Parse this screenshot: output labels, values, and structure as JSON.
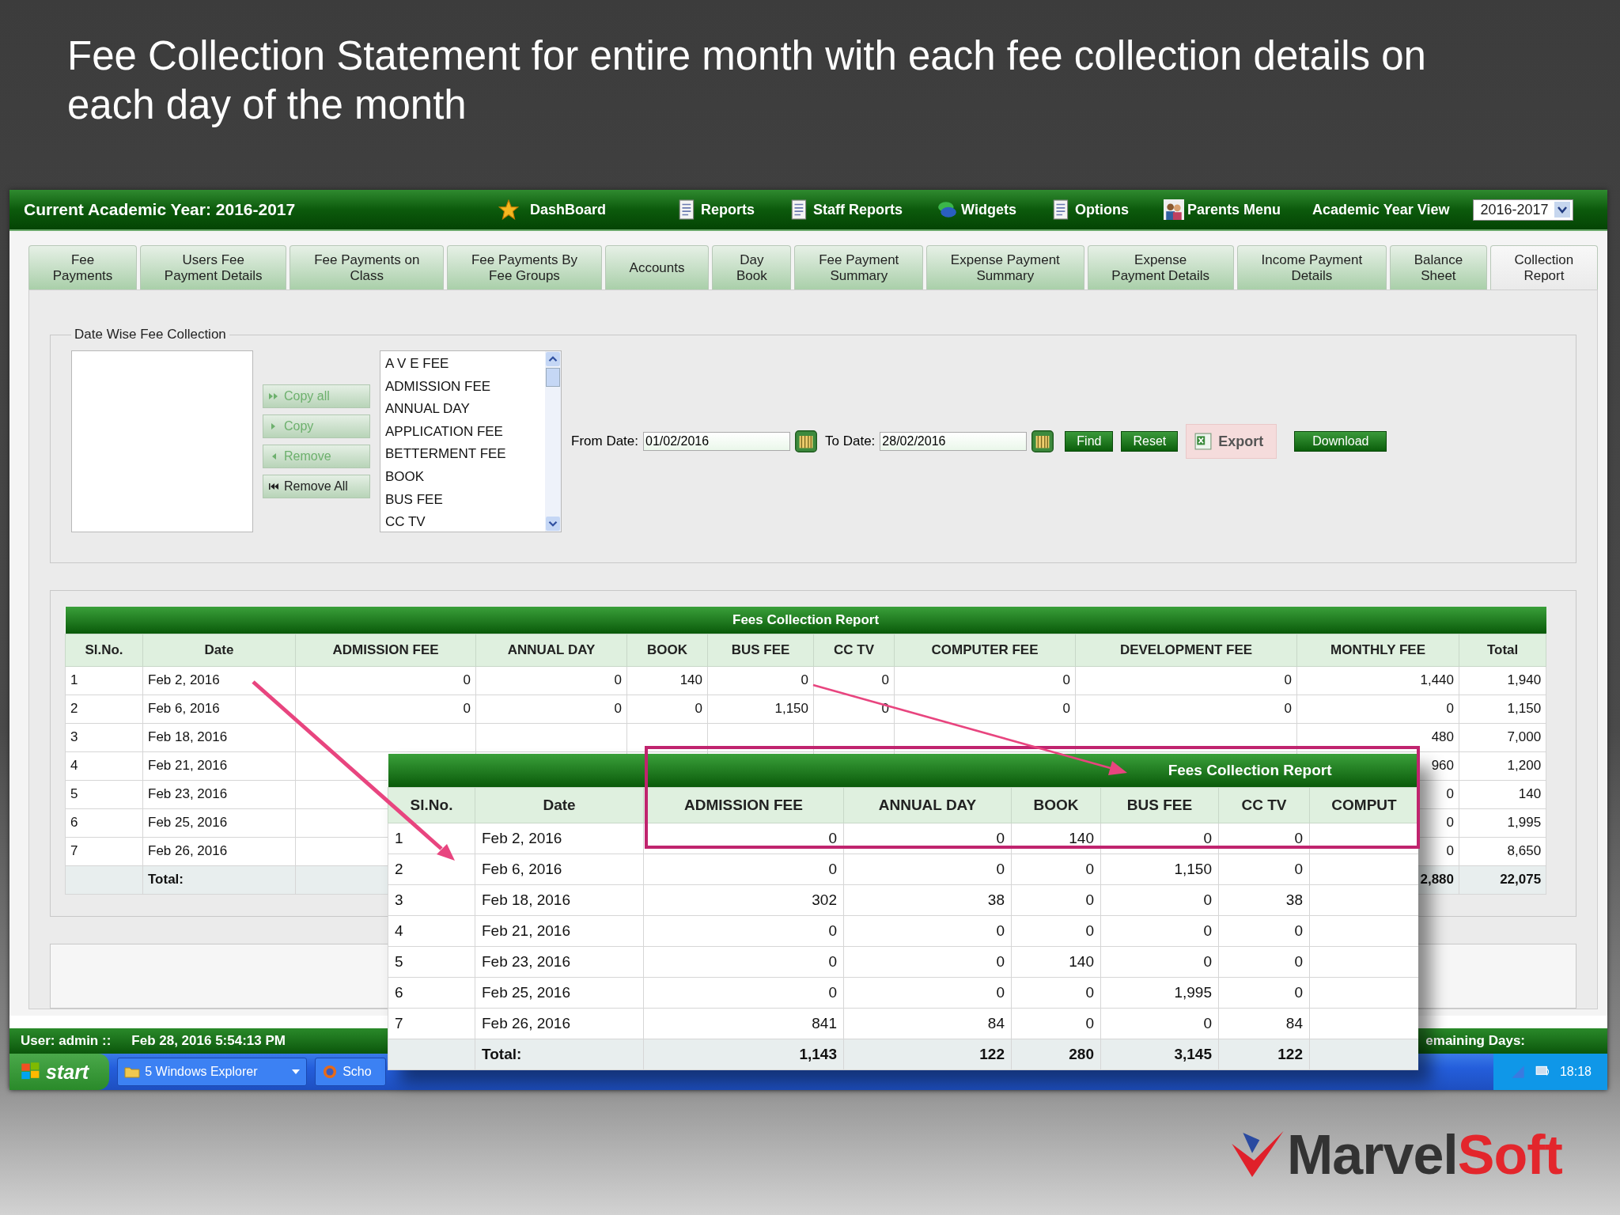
{
  "slide_title": "Fee Collection  Statement for entire month with each fee collection details on each day of the month",
  "header": {
    "title": "Current Academic Year: 2016-2017",
    "menu": [
      "DashBoard",
      "Reports",
      "Staff Reports",
      "Widgets",
      "Options",
      "Parents Menu"
    ],
    "year_view_label": "Academic Year View",
    "year_select": "2016-2017"
  },
  "tabs": [
    {
      "label": "Fee\nPayments",
      "selected": false
    },
    {
      "label": "Users Fee\nPayment Details",
      "selected": false
    },
    {
      "label": "Fee Payments on\nClass",
      "selected": false
    },
    {
      "label": "Fee Payments By\nFee Groups",
      "selected": false
    },
    {
      "label": "Accounts",
      "selected": false
    },
    {
      "label": "Day\nBook",
      "selected": false
    },
    {
      "label": "Fee Payment\nSummary",
      "selected": false
    },
    {
      "label": "Expense Payment\nSummary",
      "selected": false
    },
    {
      "label": "Expense\nPayment Details",
      "selected": false
    },
    {
      "label": "Income Payment\nDetails",
      "selected": false
    },
    {
      "label": "Balance\nSheet",
      "selected": false
    },
    {
      "label": "Collection\nReport",
      "selected": true
    }
  ],
  "filter": {
    "legend": "Date Wise Fee Collection",
    "move_buttons": [
      {
        "label": "Copy all",
        "disabled": true
      },
      {
        "label": "Copy",
        "disabled": true
      },
      {
        "label": "Remove",
        "disabled": true
      },
      {
        "label": "Remove All",
        "disabled": false
      }
    ],
    "fee_list": [
      "A V E FEE",
      "ADMISSION FEE",
      "ANNUAL DAY",
      "APPLICATION FEE",
      "BETTERMENT FEE",
      "BOOK",
      "BUS FEE",
      "CC TV"
    ],
    "from_label": "From Date:",
    "from_value": "01/02/2016",
    "to_label": "To Date:",
    "to_value": "28/02/2016",
    "actions": [
      "Find",
      "Reset"
    ],
    "export": "Export",
    "download": "Download"
  },
  "report": {
    "title": "Fees Collection Report",
    "columns": [
      "Sl.No.",
      "Date",
      "ADMISSION FEE",
      "ANNUAL DAY",
      "BOOK",
      "BUS FEE",
      "CC TV",
      "COMPUTER FEE",
      "DEVELOPMENT FEE",
      "MONTHLY FEE",
      "Total"
    ],
    "rows": [
      {
        "sl": "1",
        "date": "Feb 2, 2016",
        "fees": [
          "0",
          "0",
          "140",
          "0",
          "0",
          "0",
          "0"
        ],
        "monthly_fee": "1,440",
        "total": "1,940"
      },
      {
        "sl": "2",
        "date": "Feb 6, 2016",
        "fees": [
          "0",
          "0",
          "0",
          "1,150",
          "0",
          "0",
          "0"
        ],
        "monthly_fee": "0",
        "total": "1,150"
      },
      {
        "sl": "3",
        "date": "Feb 18, 2016",
        "monthly_fee": "480",
        "total": "7,000"
      },
      {
        "sl": "4",
        "date": "Feb 21, 2016",
        "monthly_fee": "960",
        "total": "1,200"
      },
      {
        "sl": "5",
        "date": "Feb 23, 2016",
        "monthly_fee": "0",
        "total": "140"
      },
      {
        "sl": "6",
        "date": "Feb 25, 2016",
        "monthly_fee": "0",
        "total": "1,995"
      },
      {
        "sl": "7",
        "date": "Feb 26, 2016",
        "monthly_fee": "0",
        "total": "8,650"
      }
    ],
    "total": {
      "label": "Total:",
      "monthly_fee": "2,880",
      "total": "22,075"
    }
  },
  "inset": {
    "title": "Fees Collection Report",
    "columns": [
      "Sl.No.",
      "Date",
      "ADMISSION FEE",
      "ANNUAL DAY",
      "BOOK",
      "BUS FEE",
      "CC TV",
      "COMPUT"
    ],
    "rows": [
      {
        "cells": [
          "1",
          "Feb 2, 2016",
          "0",
          "0",
          "140",
          "0",
          "0"
        ]
      },
      {
        "cells": [
          "2",
          "Feb 6, 2016",
          "0",
          "0",
          "0",
          "1,150",
          "0"
        ]
      },
      {
        "cells": [
          "3",
          "Feb 18, 2016",
          "302",
          "38",
          "0",
          "0",
          "38"
        ]
      },
      {
        "cells": [
          "4",
          "Feb 21, 2016",
          "0",
          "0",
          "0",
          "0",
          "0"
        ]
      },
      {
        "cells": [
          "5",
          "Feb 23, 2016",
          "0",
          "0",
          "140",
          "0",
          "0"
        ]
      },
      {
        "cells": [
          "6",
          "Feb 25, 2016",
          "0",
          "0",
          "0",
          "1,995",
          "0"
        ]
      },
      {
        "cells": [
          "7",
          "Feb 26, 2016",
          "841",
          "84",
          "0",
          "0",
          "84"
        ]
      }
    ],
    "total": {
      "label": "Total:",
      "values": [
        "1,143",
        "122",
        "280",
        "3,145",
        "122"
      ]
    }
  },
  "status_bar": {
    "user": "User: admin ::",
    "datetime": "Feb 28, 2016 5:54:13 PM",
    "remaining": "emaining Days:"
  },
  "taskbar": {
    "start": "start",
    "tasks": [
      "5 Windows Explorer",
      "Scho"
    ],
    "clock": "18:18"
  },
  "logo": {
    "part_1": "Marvel",
    "part_2": "Soft"
  }
}
